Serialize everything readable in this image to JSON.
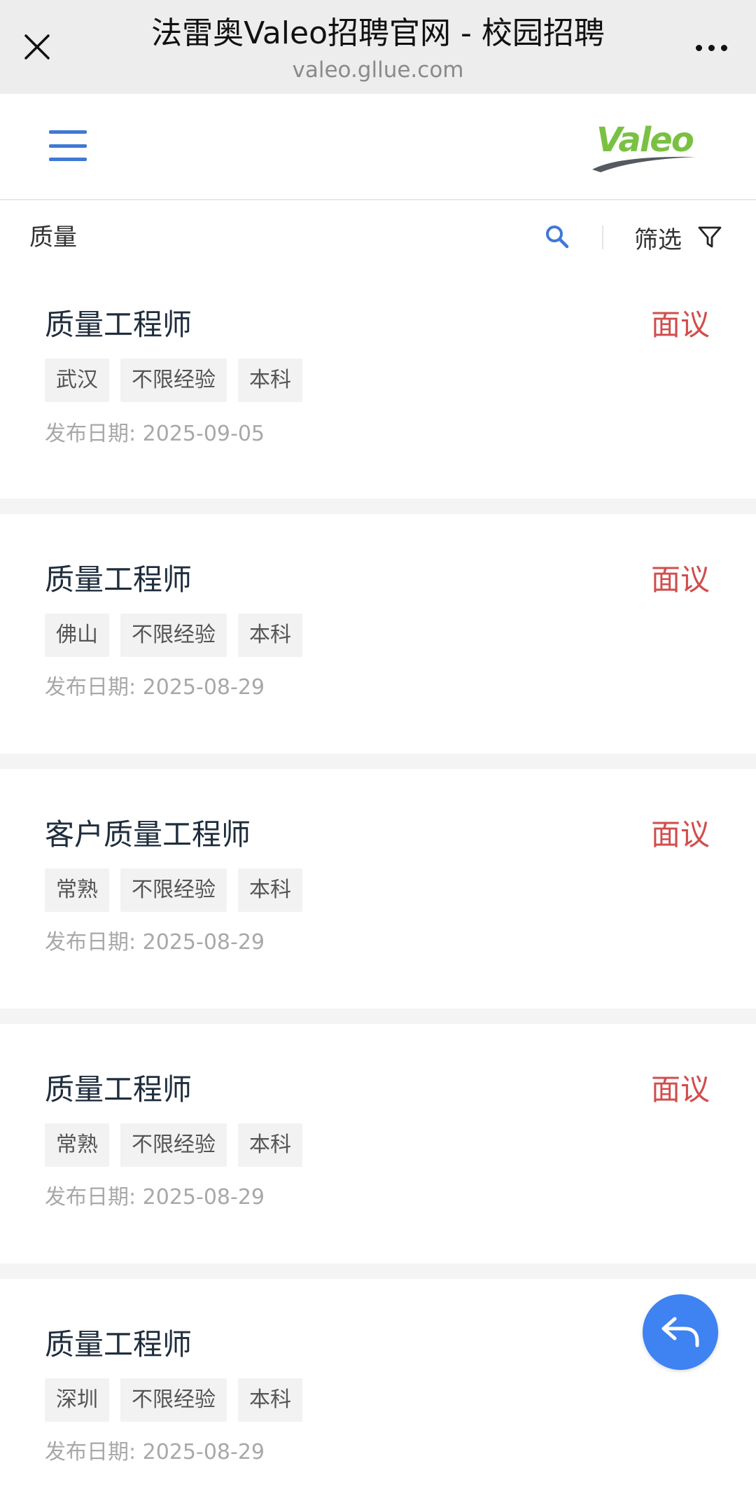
{
  "browser": {
    "title": "法雷奥Valeo招聘官网 - 校园招聘",
    "url": "valeo.gllue.com"
  },
  "header": {
    "logo_text": "Valeo",
    "brand_color": "#7ac143"
  },
  "search": {
    "query": "质量",
    "filter_label": "筛选"
  },
  "jobs": [
    {
      "title": "质量工程师",
      "salary": "面议",
      "tags": [
        "武汉",
        "不限经验",
        "本科"
      ],
      "date": "发布日期: 2025-09-05"
    },
    {
      "title": "质量工程师",
      "salary": "面议",
      "tags": [
        "佛山",
        "不限经验",
        "本科"
      ],
      "date": "发布日期: 2025-08-29"
    },
    {
      "title": "客户质量工程师",
      "salary": "面议",
      "tags": [
        "常熟",
        "不限经验",
        "本科"
      ],
      "date": "发布日期: 2025-08-29"
    },
    {
      "title": "质量工程师",
      "salary": "面议",
      "tags": [
        "常熟",
        "不限经验",
        "本科"
      ],
      "date": "发布日期: 2025-08-29"
    },
    {
      "title": "质量工程师",
      "salary": "",
      "tags": [
        "深圳",
        "不限经验",
        "本科"
      ],
      "date": "发布日期: 2025-08-29"
    }
  ],
  "colors": {
    "accent": "#3f78d6",
    "salary": "#d24d4d",
    "fab": "#3f82f1"
  },
  "icons": {
    "close": "close-icon",
    "more": "more-icon",
    "menu": "hamburger-icon",
    "search": "search-icon",
    "filter": "filter-icon",
    "back": "back-arrow-icon"
  }
}
